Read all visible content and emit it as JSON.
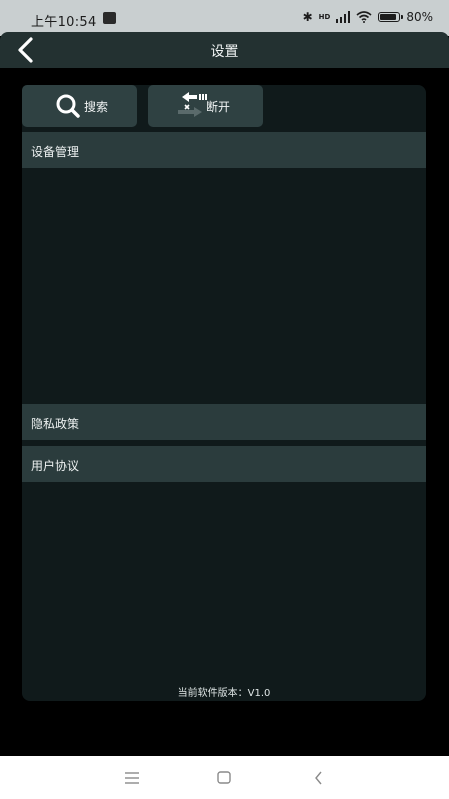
{
  "status_bar": {
    "time": "上午10:54",
    "network": "HD",
    "battery": "80%"
  },
  "header": {
    "title": "设置"
  },
  "toolbar": {
    "search_label": "搜索",
    "disconnect_label": "断开"
  },
  "sections": {
    "device_management": "设备管理",
    "privacy_policy": "隐私政策",
    "user_agreement": "用户协议"
  },
  "footer": {
    "version": "当前软件版本：V1.0"
  },
  "icons": {
    "back": "chevron-left-icon",
    "search": "magnifier-icon",
    "disconnect": "disconnect-arrow-icon"
  },
  "colors": {
    "panel": "#101a1b",
    "section": "#2b3c3d",
    "button": "#2f4142",
    "header": "#233131"
  }
}
